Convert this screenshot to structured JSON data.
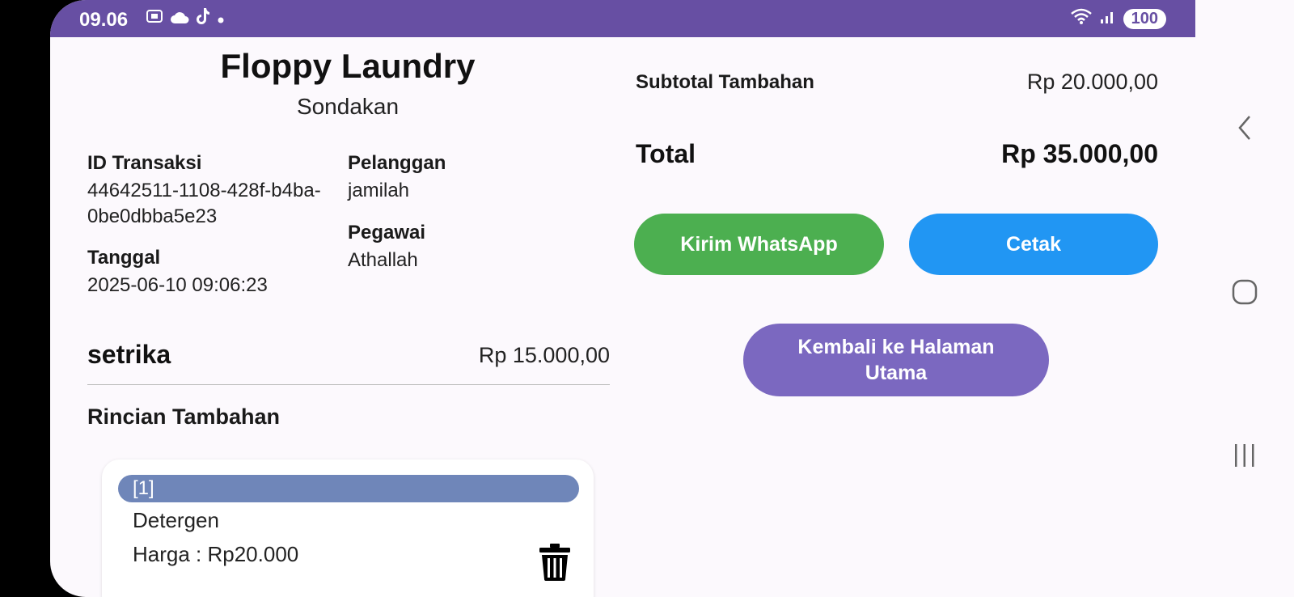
{
  "status_bar": {
    "time": "09.06",
    "left_icons": [
      "screenshot-icon",
      "cloud-icon",
      "tiktok-icon",
      "dot-icon"
    ],
    "battery": "100"
  },
  "header": {
    "title": "Floppy Laundry",
    "subtitle": "Sondakan"
  },
  "transaction": {
    "id_label": "ID Transaksi",
    "id_value_line1": "44642511-1108-428f-b4ba-",
    "id_value_line2": "0be0dbba5e23",
    "date_label": "Tanggal",
    "date_value": "2025-06-10 09:06:23",
    "customer_label": "Pelanggan",
    "customer_value": "jamilah",
    "employee_label": "Pegawai",
    "employee_value": "Athallah"
  },
  "service": {
    "name": "setrika",
    "price": "Rp 15.000,00"
  },
  "extras": {
    "heading": "Rincian Tambahan",
    "items": [
      {
        "index": "[1]",
        "name": "Detergen",
        "price": "Harga : Rp20.000"
      }
    ]
  },
  "summary": {
    "subtotal_label": "Subtotal Tambahan",
    "subtotal_value": "Rp 20.000,00",
    "total_label": "Total",
    "total_value": "Rp 35.000,00"
  },
  "actions": {
    "whatsapp": "Kirim WhatsApp",
    "print": "Cetak",
    "back": "Kembali ke Halaman Utama"
  },
  "colors": {
    "status_bar": "#674fa3",
    "whatsapp": "#4caf50",
    "print": "#2196f3",
    "back": "#7b68c0",
    "item_index_bar": "#6f86b9"
  }
}
